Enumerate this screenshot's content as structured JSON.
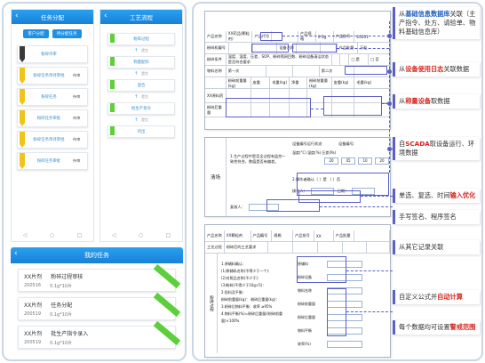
{
  "phone1": {
    "title": "任务分配",
    "tabs": [
      "客户分配",
      "待分配任务"
    ],
    "cards": [
      {
        "text": "粉碎待审",
        "status": "",
        "flag": "#3a3a3a"
      },
      {
        "text": "粉碎任务单待审批",
        "status": "待审",
        "flag": "#f0c419"
      },
      {
        "text": "粉碎任务",
        "status": "待审",
        "flag": "#f0c419"
      },
      {
        "text": "粉碎任务审批",
        "status": "待审",
        "flag": "#f0c419"
      },
      {
        "text": "粉碎任务单待审批",
        "status": "待审",
        "flag": "#f0c419"
      },
      {
        "text": "粉碎任务审批",
        "status": "待审",
        "flag": "#f0c419"
      }
    ],
    "nav": [
      "◁",
      "○",
      "□"
    ]
  },
  "phone2": {
    "title": "工艺流程",
    "steps": [
      "粉碎过程",
      "称量配料",
      "混合",
      "批生产指令",
      "待出"
    ],
    "arrow_note": "提交",
    "nav": [
      "◁",
      "○",
      "□"
    ]
  },
  "phone3": {
    "title": "我的任务",
    "tasks": [
      {
        "product": "XX片剂",
        "name": "粉碎过程审核",
        "batch": "200516",
        "spec": "0.1g*10片"
      },
      {
        "product": "XX片剂",
        "name": "任务分配",
        "batch": "200519",
        "spec": "0.1g*10片"
      },
      {
        "product": "XX片剂",
        "name": "批生产指令录入",
        "batch": "200519",
        "spec": "0.1g*10片"
      }
    ]
  },
  "form1": {
    "row1": [
      "产品名称",
      "XX药品(颗粒剂)",
      "产品代号",
      "",
      "产品规格",
      "0.5g",
      "产品批号",
      "20201"
    ],
    "row2": [
      "粉碎机编号",
      "",
      "",
      "设备名称",
      "",
      "",
      "产品批量",
      "万粒"
    ],
    "row3": [
      "粉碎条件",
      "温度、湿度、压差、SOP、粉碎筛网目数、粉碎设备清洁状态是否符合要求",
      "",
      "",
      "□ 是",
      "□ 否"
    ],
    "row4": [
      "物料名称",
      "第一次",
      "",
      "",
      "第二次",
      ""
    ],
    "row5": [
      "",
      "粉碎前重量(kg)",
      "皮重",
      "毛重(kg)",
      "净重",
      "粉碎前重量(kg)",
      "皮重(kg)",
      "毛重(kg)"
    ],
    "row6": [
      "XX原料药",
      "",
      "",
      "",
      "",
      "",
      "",
      ""
    ],
    "row7": [
      "粉碎后重量",
      "",
      "",
      "",
      "",
      "",
      "",
      ""
    ]
  },
  "form2": {
    "left_label": "清场",
    "item1": "1.生产过程中是否全过程有监控一致性符合，数值是否有偏差。",
    "device_status": "设备编号运行状态",
    "device_id": "设备编号：",
    "env_label": "温度(°C) 湿度(%) 压差(Pa)",
    "env_values": [
      "20",
      "45",
      "10",
      "20"
    ],
    "confirm": "2.操作者确认（ ）是 （ ）否",
    "reviewer": "复核人：",
    "operator": "操作人：",
    "date": "日期："
  },
  "form3": {
    "row1": [
      "产品名称",
      "XX颗粒剂",
      "产品编号",
      "规格",
      "产品批号",
      "XX",
      "产品批量",
      ""
    ],
    "row2": [
      "工艺过程",
      "粉碎后的工艺要求",
      "",
      "",
      "",
      "",
      ""
    ],
    "left_label": "粉碎过程",
    "steps": [
      "1.原辅料确认：",
      "(1)原辅料名称(不得少于一个)：",
      "(2)对照品名称(不少于)：",
      "(3)粉碎(不得少于10g×5)：",
      "2.投料及平衡：",
      "粉碎前重量(kg)：  粉碎后重量(kg)：",
      "3.粉碎后物料平衡：收率 ≥95%",
      "4.物料平衡(%)=粉碎后重量/(粉碎前重量)×100%"
    ],
    "fields": [
      "原辅料",
      "粉碎设备",
      "物料名称",
      "粉碎前重量",
      "粉碎后重量",
      "物料平衡",
      "收率(%)"
    ]
  },
  "callouts": [
    {
      "pre": "从",
      "hl": "基础信息数据库",
      "post": "关联（主产指令、处方、请验单、物料基础信息库）"
    },
    {
      "pre": "从",
      "hl": "设备使用日志",
      "post": "关联数据"
    },
    {
      "pre": "从",
      "hl": "称量设备",
      "post": "取数据"
    },
    {
      "pre": "自",
      "hl": "SCADA",
      "post": "取设备运行、环境数据"
    },
    {
      "pre": "单选、复选、时间",
      "hl": "输入优化",
      "post": ""
    },
    {
      "pre": "手写签名、程序签名",
      "hl": "",
      "post": ""
    },
    {
      "pre": "从其它记录关联",
      "hl": "",
      "post": ""
    },
    {
      "pre": "自定义公式并",
      "hl": "自动计算",
      "post": ""
    },
    {
      "pre": "每个数据均可设置",
      "hl": "警戒范围",
      "post": ""
    }
  ],
  "colors": {
    "accent": "#1f8fe6",
    "callout_border": "#5b5fc7",
    "highlight": "#d7261e",
    "flag_green": "#5dcf3a",
    "flag_yellow": "#f0c419"
  }
}
